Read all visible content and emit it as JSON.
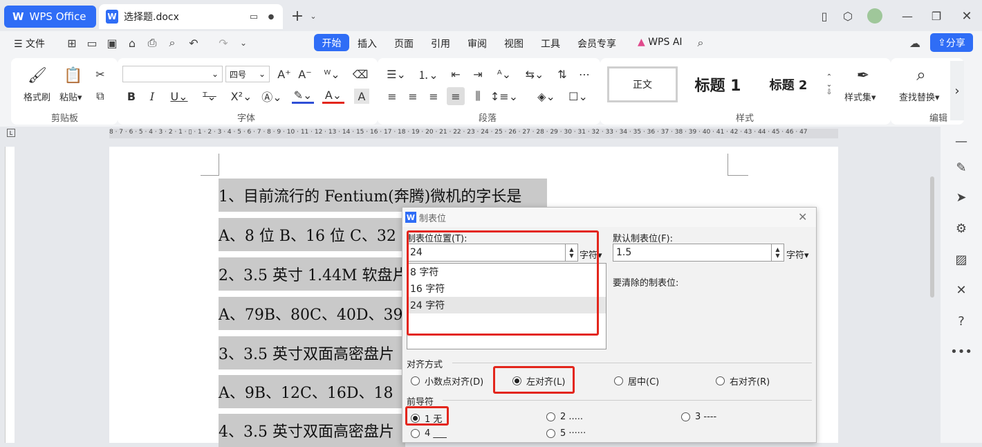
{
  "app": {
    "name": "WPS Office",
    "logo_glyph": "W",
    "doc_tab": "选择题.docx"
  },
  "menubar": {
    "file": "文件",
    "tabs": [
      "开始",
      "插入",
      "页面",
      "引用",
      "审阅",
      "视图",
      "工具",
      "会员专享"
    ],
    "active_tab": "开始",
    "wps_ai": "WPS AI",
    "share": "分享"
  },
  "ribbon": {
    "clipboard": {
      "format_painter": "格式刷",
      "paste": "粘贴",
      "group": "剪贴板"
    },
    "font": {
      "font_name": "",
      "font_size": "四号",
      "group": "字体"
    },
    "paragraph": {
      "group": "段落"
    },
    "styles": {
      "normal": "正文",
      "h1": "标题 1",
      "h2": "标题 2",
      "style_set": "样式集",
      "group": "样式"
    },
    "edit": {
      "find_replace": "查找替换",
      "group": "编辑"
    }
  },
  "ruler": {
    "marks": "8 · 7 · 6 · 5 · 4 · 3 · 2 · 1 · ▯ · 1 · 2 · 3 · 4 · 5 · 6 · 7 · 8 · 9 · 10 · 11 · 12 · 13 · 14 · 15 · 16 · 17 · 18 · 19 · 20 · 21 · 22 · 23 · 24 · 25 · 26 · 27 · 28 · 29 · 30 · 31 · 32 · 33 · 34 · 35 · 36 · 37 · 38 · 39 · 40 · 41 · 42 · 43 · 44 · 45 · 46 · 47"
  },
  "document": {
    "lines": [
      "1、目前流行的 Fentium(奔腾)微机的字长是",
      "A、8 位 B、16 位 C、32",
      "2、3.5 英寸 1.44M 软盘片",
      "A、79B、80C、40D、39",
      "3、3.5 英寸双面高密盘片",
      "A、9B、12C、16D、18",
      "4、3.5 英寸双面高密盘片"
    ]
  },
  "dialog": {
    "title": "制表位",
    "tab_position_label": "制表位位置(T):",
    "tab_position_value": "24",
    "unit": "字符",
    "default_tab_label": "默认制表位(F):",
    "default_tab_value": "1.5",
    "clear_label": "要清除的制表位:",
    "tab_list": [
      "8 字符",
      "16 字符",
      "24 字符"
    ],
    "align_label": "对齐方式",
    "align_options": [
      "小数点对齐(D)",
      "左对齐(L)",
      "居中(C)",
      "右对齐(R)"
    ],
    "align_selected": "左对齐(L)",
    "leader_label": "前导符",
    "leader_options": [
      "1 无",
      "2 .....",
      "3 ----",
      "4 ___",
      "5 ······"
    ],
    "leader_selected": "1 无"
  },
  "colors": {
    "accent": "#2f6df6",
    "highlight_red": "#e3261c",
    "selection": "#c9c9c9"
  }
}
